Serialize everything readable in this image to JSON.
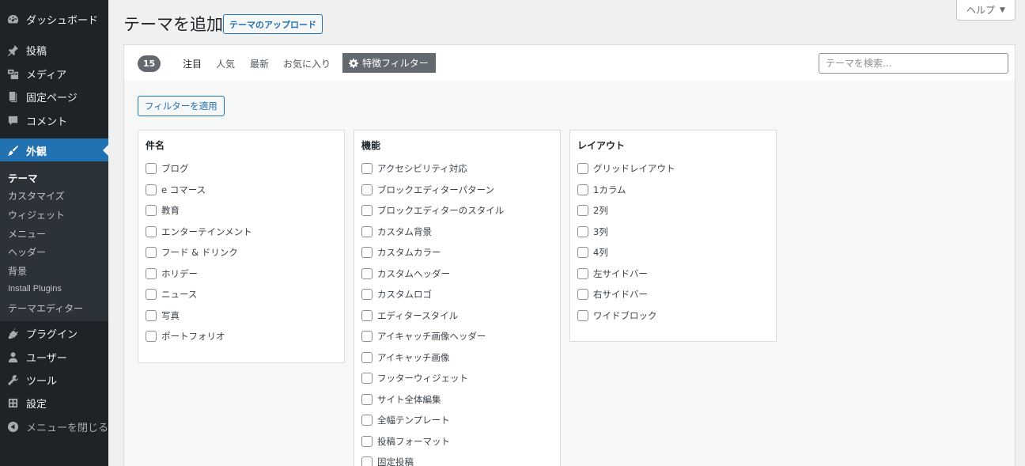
{
  "sidebar": {
    "items": [
      {
        "label": "ダッシュボード",
        "icon": "dashboard-icon"
      },
      {
        "label": "投稿",
        "icon": "pin-icon"
      },
      {
        "label": "メディア",
        "icon": "media-icon"
      },
      {
        "label": "固定ページ",
        "icon": "page-icon"
      },
      {
        "label": "コメント",
        "icon": "comment-icon"
      },
      {
        "label": "外観",
        "icon": "brush-icon"
      },
      {
        "label": "プラグイン",
        "icon": "plugin-icon"
      },
      {
        "label": "ユーザー",
        "icon": "user-icon"
      },
      {
        "label": "ツール",
        "icon": "wrench-icon"
      },
      {
        "label": "設定",
        "icon": "settings-icon"
      },
      {
        "label": "メニューを閉じる",
        "icon": "collapse-icon"
      }
    ],
    "submenu": [
      "テーマ",
      "カスタマイズ",
      "ウィジェット",
      "メニュー",
      "ヘッダー",
      "背景",
      "Install Plugins",
      "テーマエディター"
    ]
  },
  "header": {
    "title": "テーマを追加",
    "upload_label": "テーマのアップロード",
    "help_label": "ヘルプ",
    "help_arrow": "▼"
  },
  "filter_bar": {
    "count": "15",
    "links": [
      "注目",
      "人気",
      "最新",
      "お気に入り"
    ],
    "feature_filter_label": "特徴フィルター",
    "search_placeholder": "テーマを検索..."
  },
  "apply_label": "フィルターを適用",
  "groups": [
    {
      "title": "件名",
      "options": [
        "ブログ",
        "e コマース",
        "教育",
        "エンターテインメント",
        "フード & ドリンク",
        "ホリデー",
        "ニュース",
        "写真",
        "ポートフォリオ"
      ]
    },
    {
      "title": "機能",
      "options": [
        "アクセシビリティ対応",
        "ブロックエディターパターン",
        "ブロックエディターのスタイル",
        "カスタム背景",
        "カスタムカラー",
        "カスタムヘッダー",
        "カスタムロゴ",
        "エディタースタイル",
        "アイキャッチ画像ヘッダー",
        "アイキャッチ画像",
        "フッターウィジェット",
        "サイト全体編集",
        "全幅テンプレート",
        "投稿フォーマット",
        "固定投稿"
      ]
    },
    {
      "title": "レイアウト",
      "options": [
        "グリッドレイアウト",
        "1カラム",
        "2列",
        "3列",
        "4列",
        "左サイドバー",
        "右サイドバー",
        "ワイドブロック"
      ]
    }
  ],
  "colors": {
    "sidebar_bg": "#1d2327",
    "submenu_bg": "#2c3338",
    "accent": "#2271b1",
    "page_bg": "#f0f0f1"
  }
}
